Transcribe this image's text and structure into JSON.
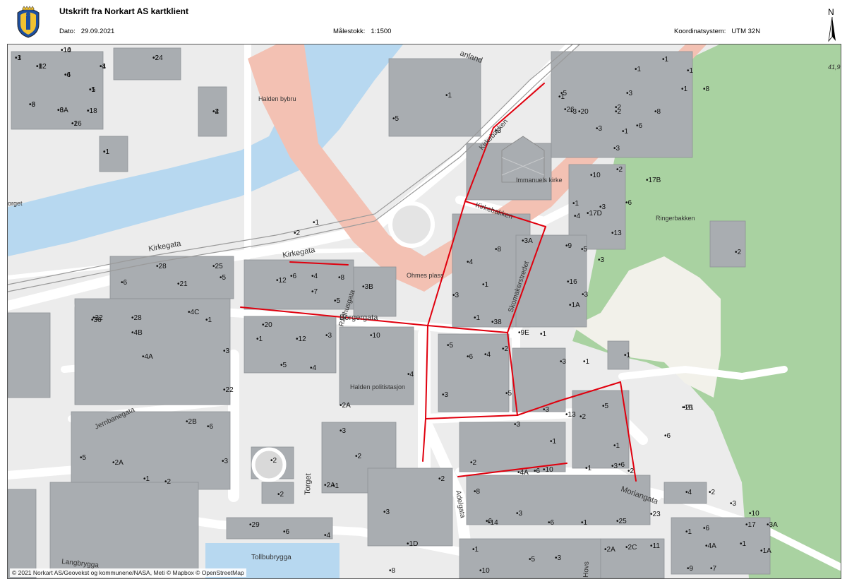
{
  "header": {
    "title": "Utskrift fra Norkart AS kartklient",
    "date_label": "Dato:",
    "date_value": "29.09.2021",
    "scale_label": "Målestokk:",
    "scale_value": "1:1500",
    "crs_label": "Koordinatsystem:",
    "crs_value": "UTM 32N",
    "north_label": "N"
  },
  "map": {
    "attribution": "© 2021 Norkart AS/Geovekst og kommunene/NASA, Meti © Mapbox © OpenStreetMap",
    "colors": {
      "background": "#ececec",
      "water": "#b7d8f0",
      "road": "#ffffff",
      "main_road": "#f3c1b3",
      "building": "#a9adb1",
      "park": "#a9d2a1",
      "route": "#e0000e"
    },
    "street_labels": [
      "Kirkegata",
      "Kirkegata",
      "Rådhusgata",
      "Borgergata",
      "Torget",
      "Jernbanegata",
      "Langbrygga",
      "Adelgata",
      "Moriangata",
      "Kirkebakken",
      "Kirkebakken",
      "Skomakerstredet",
      "Ringerbakken",
      "Tollbubrygga",
      "Hovs",
      "anland"
    ],
    "place_labels": [
      "Halden bybru",
      "Ohmes plass",
      "Immanuels kirke",
      "Halden politistasjon",
      "orget",
      "41,9"
    ],
    "address_labels": [
      "1",
      "10",
      "8",
      "6",
      "5",
      "3",
      "6A",
      "1",
      "2",
      "1",
      "2",
      "1",
      "2",
      "2",
      "1",
      "5",
      "3",
      "26",
      "20",
      "28",
      "25",
      "6",
      "21",
      "5",
      "12",
      "6",
      "4",
      "8",
      "7",
      "5",
      "3B",
      "8",
      "3A",
      "4",
      "1",
      "3",
      "1",
      "38",
      "32",
      "28",
      "4C",
      "1",
      "36",
      "4B",
      "3",
      "4A",
      "22",
      "20",
      "12",
      "3",
      "1",
      "5",
      "4",
      "10",
      "4",
      "5",
      "6",
      "4",
      "2",
      "3",
      "5",
      "3",
      "2",
      "2A",
      "2B",
      "6",
      "5",
      "2A",
      "3",
      "1",
      "2",
      "2",
      "2",
      "2A",
      "1",
      "3",
      "1D",
      "29",
      "6",
      "4",
      "2",
      "1",
      "6",
      "3",
      "1",
      "2",
      "4A",
      "6",
      "8",
      "14",
      "10",
      "3",
      "6",
      "1",
      "25",
      "23",
      "21",
      "17",
      "13",
      "2",
      "3",
      "5",
      "1",
      "6",
      "2",
      "1",
      "3",
      "1",
      "3",
      "2",
      "1",
      "1",
      "1",
      "1",
      "8",
      "5",
      "3",
      "2",
      "8",
      "3",
      "1",
      "3",
      "2",
      "10",
      "17B",
      "17D",
      "3",
      "6",
      "1",
      "4",
      "13",
      "2",
      "9",
      "5",
      "3",
      "16",
      "3",
      "1A",
      "9E",
      "1",
      "3",
      "1",
      "1",
      "1B",
      "6",
      "4",
      "2",
      "3",
      "10",
      "3A",
      "1",
      "6",
      "4A",
      "1",
      "1A",
      "2A",
      "2C",
      "11",
      "9",
      "7",
      "5",
      "3",
      "10",
      "8",
      "1",
      "6",
      "3",
      "14",
      "12",
      "4",
      "1",
      "6",
      "3",
      "18",
      "16",
      "4",
      "24",
      "1",
      "4"
    ]
  }
}
